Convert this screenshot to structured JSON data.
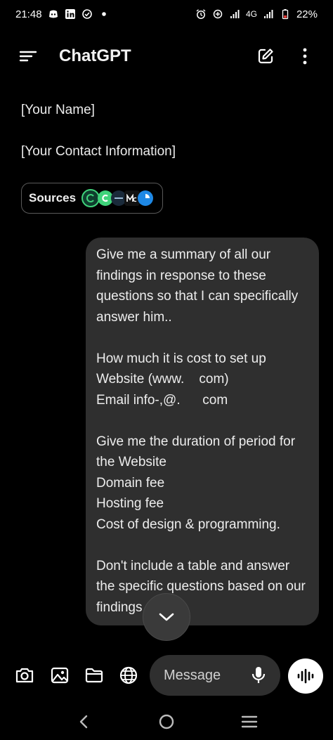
{
  "status_bar": {
    "time": "21:48",
    "network": "4G",
    "battery": "22%",
    "left_icons": [
      "discord-icon",
      "linkedin-icon",
      "check-circle-icon",
      "dot-icon"
    ],
    "right_icons": [
      "alarm-icon",
      "data-saver-icon",
      "signal-icon",
      "signal-icon",
      "battery-icon"
    ]
  },
  "header": {
    "title": "ChatGPT",
    "menu_icon": "menu-icon",
    "new_chat_icon": "edit-icon",
    "more_icon": "more-vertical-icon"
  },
  "conversation": {
    "assistant_lines": [
      "[Your Name]",
      "[Your Contact Information]"
    ],
    "sources_label": "Sources",
    "user_message": "Give me a summary of all our findings in response to these questions so that I can specifically answer him..\n\nHow much it is cost to set up Website (www.    com)\nEmail info-,@.      com\n\nGive me the duration of period for the Website\nDomain fee\nHosting fee\nCost of design & programming.\n\nDon't include a table and answer the specific questions based on our findings"
  },
  "composer": {
    "placeholder": "Message",
    "tools": [
      "camera-icon",
      "image-icon",
      "folder-icon",
      "globe-icon"
    ]
  },
  "colors": {
    "background": "#000000",
    "bubble": "#2f2f2f",
    "text": "#ececec"
  }
}
